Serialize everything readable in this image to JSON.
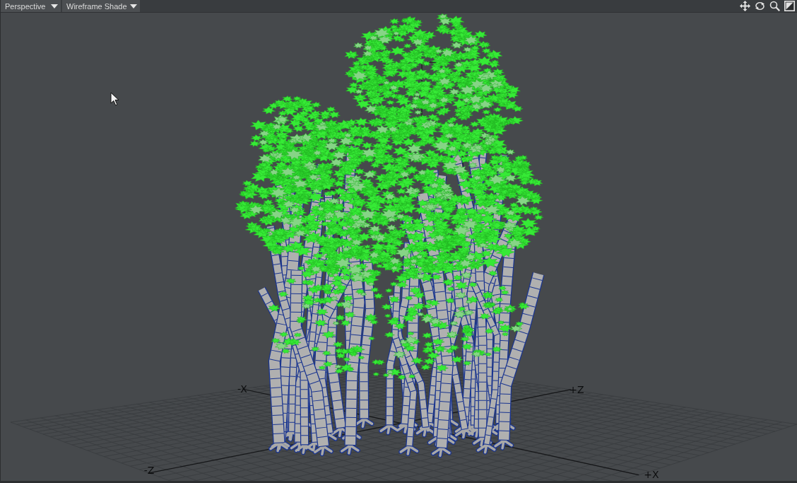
{
  "toolbar": {
    "view_menu": "Perspective",
    "shading_menu": "Wireframe Shade"
  },
  "viewport": {
    "axis_labels": [
      "-X",
      "+Z",
      "+X",
      "-Z"
    ]
  }
}
